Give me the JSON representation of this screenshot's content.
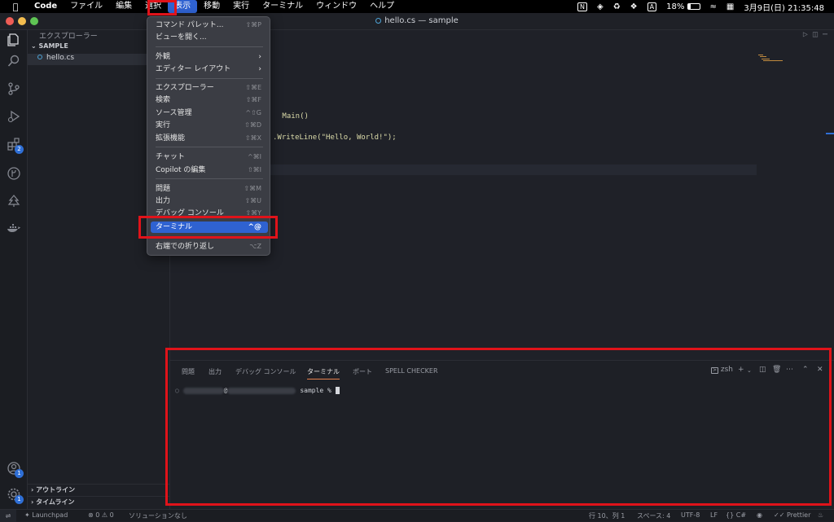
{
  "menubar": {
    "app": "Code",
    "items": [
      "ファイル",
      "編集",
      "選択",
      "表示",
      "移動",
      "実行",
      "ターミナル",
      "ウィンドウ",
      "ヘルプ"
    ],
    "active_index": 3,
    "status": {
      "battery": "18%",
      "datetime": "3月9日(日) 21:35:48",
      "input_method": "A"
    }
  },
  "window": {
    "title": "hello.cs — sample"
  },
  "sidebar": {
    "header": "エクスプローラー",
    "folder": "SAMPLE",
    "file": "hello.cs",
    "sections": [
      "アウトライン",
      "タイムライン"
    ]
  },
  "activity_bar": {
    "extensions_badge": "2",
    "accounts_badge": "1",
    "settings_badge": "1"
  },
  "editor": {
    "lines": [
      {
        "text": " Main()"
      },
      {
        "text": ".WriteLine(\"Hello, World!\");"
      }
    ]
  },
  "menu": {
    "groups": [
      [
        {
          "label": "コマンド パレット...",
          "shortcut": "⇧⌘P"
        },
        {
          "label": "ビューを開く...",
          "shortcut": ""
        }
      ],
      [
        {
          "label": "外観",
          "submenu": true
        },
        {
          "label": "エディター レイアウト",
          "submenu": true
        }
      ],
      [
        {
          "label": "エクスプローラー",
          "shortcut": "⇧⌘E"
        },
        {
          "label": "検索",
          "shortcut": "⇧⌘F"
        },
        {
          "label": "ソース管理",
          "shortcut": "^⇧G"
        },
        {
          "label": "実行",
          "shortcut": "⇧⌘D"
        },
        {
          "label": "拡張機能",
          "shortcut": "⇧⌘X"
        }
      ],
      [
        {
          "label": "チャット",
          "shortcut": "^⌘I"
        },
        {
          "label": "Copilot の編集",
          "shortcut": "⇧⌘I"
        }
      ],
      [
        {
          "label": "問題",
          "shortcut": "⇧⌘M"
        },
        {
          "label": "出力",
          "shortcut": "⇧⌘U"
        },
        {
          "label": "デバッグ コンソール",
          "shortcut": "⇧⌘Y"
        },
        {
          "label": "ターミナル",
          "shortcut": "^@",
          "selected": true
        }
      ],
      [
        {
          "label": "右端での折り返し",
          "shortcut": "⌥Z"
        }
      ]
    ]
  },
  "panel": {
    "tabs": [
      "問題",
      "出力",
      "デバッグ コンソール",
      "ターミナル",
      "ポート",
      "SPELL CHECKER"
    ],
    "active_tab": 3,
    "shell": "zsh",
    "prompt_at": "@",
    "prompt_dir": "sample %"
  },
  "statusbar": {
    "launchpad": "Launchpad",
    "errors": "0",
    "warnings": "0",
    "solution": "ソリューションなし",
    "position": "行 10、列 1",
    "spaces": "スペース: 4",
    "encoding": "UTF-8",
    "eol": "LF",
    "language": "C#",
    "prettier": "Prettier"
  },
  "colors": {
    "accent": "#2f62d1",
    "highlight_box": "#e0131a",
    "terminal_tab_underline": "#e8814d"
  }
}
